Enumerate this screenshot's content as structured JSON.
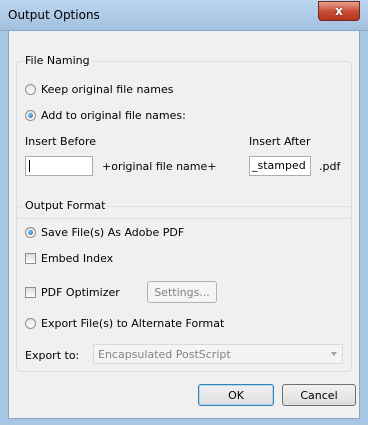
{
  "window": {
    "title": "Output Options",
    "close_label": "x"
  },
  "file_naming": {
    "legend": "File Naming",
    "keep_original_label": "Keep original file names",
    "add_to_original_label": "Add to original file names:",
    "selected": "add_to_original",
    "insert_before_label": "Insert Before",
    "insert_before_value": "",
    "middle_text": "+original file name+",
    "insert_after_label": "Insert After",
    "insert_after_value": "_stamped",
    "extension": ".pdf"
  },
  "output_format": {
    "legend": "Output Format",
    "save_as_pdf_label": "Save File(s) As Adobe PDF",
    "save_as_pdf_selected": true,
    "embed_index_label": "Embed Index",
    "embed_index_checked": false,
    "pdf_optimizer_label": "PDF Optimizer",
    "pdf_optimizer_checked": false,
    "settings_button_label": "Settings...",
    "export_alternate_label": "Export File(s) to Alternate Format",
    "export_alternate_selected": false,
    "export_to_label": "Export to:",
    "export_to_value": "Encapsulated PostScript"
  },
  "buttons": {
    "ok_label": "OK",
    "cancel_label": "Cancel"
  }
}
